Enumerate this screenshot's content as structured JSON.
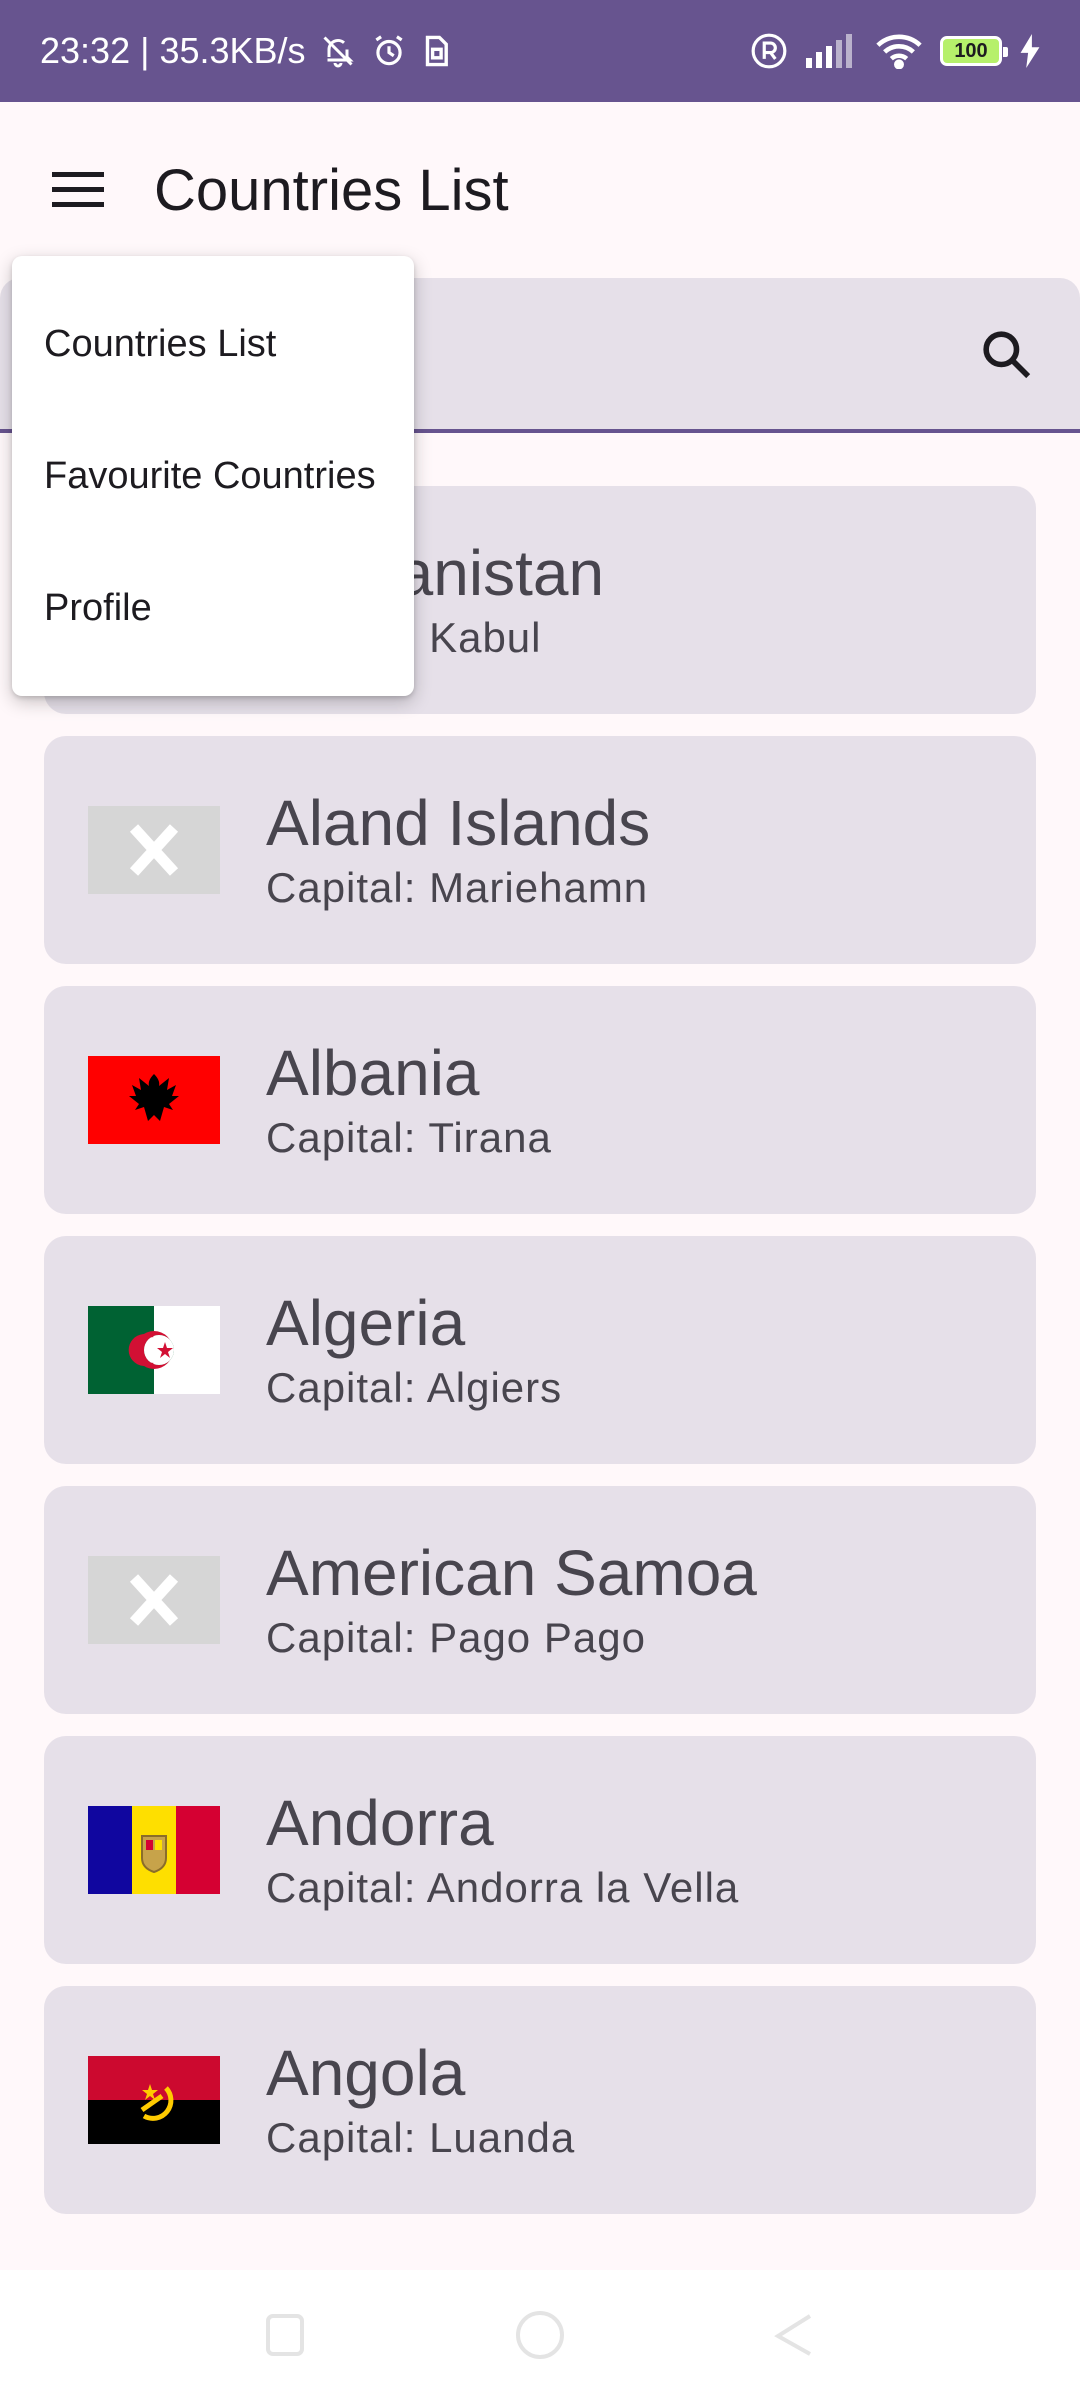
{
  "status_bar": {
    "time_speed": "23:32 | 35.3KB/s",
    "battery": "100"
  },
  "app_bar": {
    "title": "Countries List"
  },
  "menu": {
    "items": [
      "Countries List",
      "Favourite Countries",
      "Profile"
    ]
  },
  "countries": [
    {
      "name": "Afghanistan",
      "capital": "Capital: Kabul",
      "flag": "hidden"
    },
    {
      "name": "Aland Islands",
      "capital": "Capital: Mariehamn",
      "flag": "missing-image-icon"
    },
    {
      "name": "Albania",
      "capital": "Capital: Tirana",
      "flag": "albania-flag"
    },
    {
      "name": "Algeria",
      "capital": "Capital: Algiers",
      "flag": "algeria-flag"
    },
    {
      "name": "American Samoa",
      "capital": "Capital: Pago Pago",
      "flag": "missing-image-icon"
    },
    {
      "name": "Andorra",
      "capital": "Capital: Andorra la Vella",
      "flag": "andorra-flag"
    },
    {
      "name": "Angola",
      "capital": "Capital: Luanda",
      "flag": "angola-flag"
    }
  ],
  "colors": {
    "status_bar": "#67548f",
    "card": "#e6e0e9",
    "background": "#fff8fa",
    "text": "#48454e"
  }
}
